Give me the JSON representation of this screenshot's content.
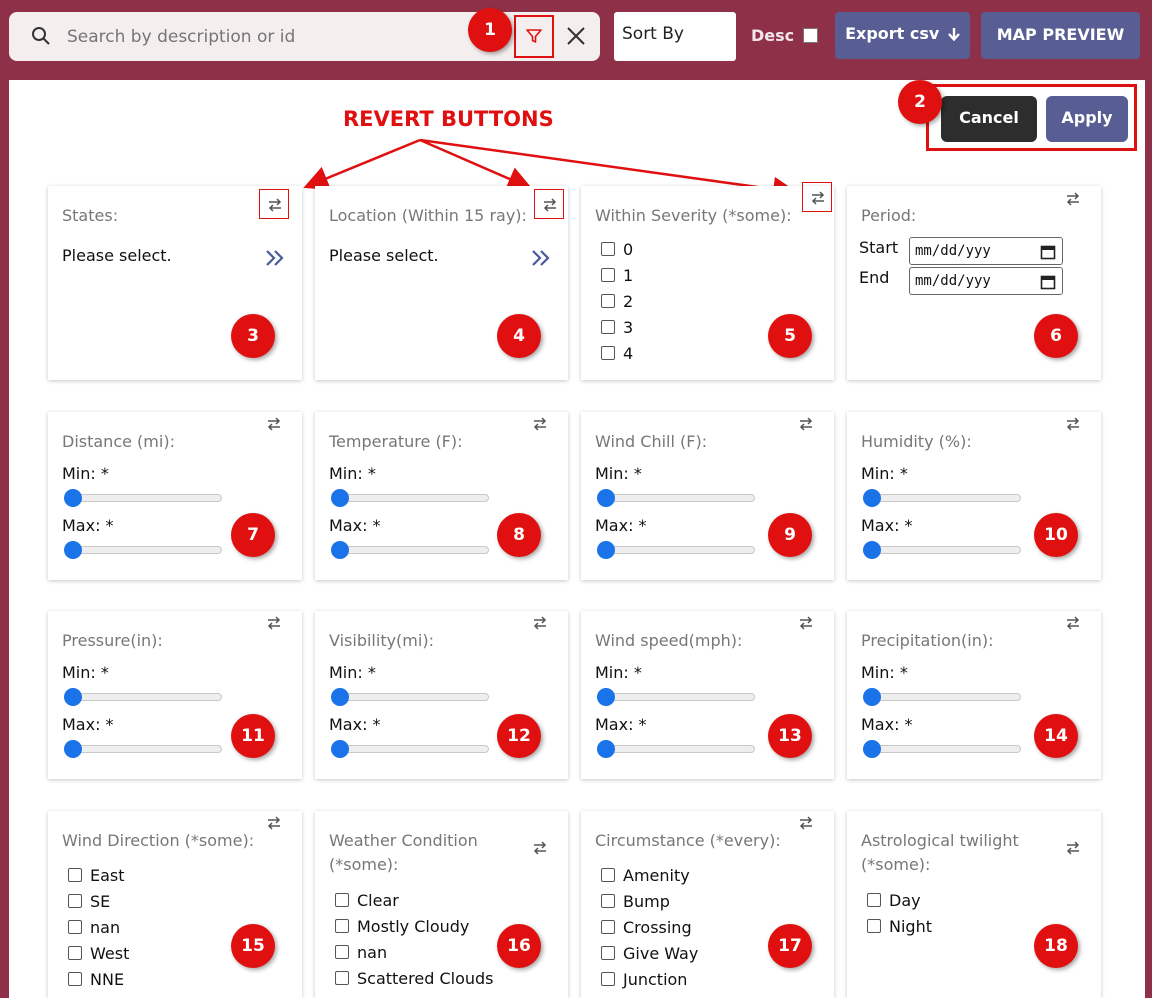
{
  "search": {
    "placeholder": "Search by description or id"
  },
  "toolbar": {
    "sort_by": "Sort By",
    "desc_label": "Desc",
    "export_label": "Export csv",
    "map_preview_label": "MAP PREVIEW",
    "cancel_label": "Cancel",
    "apply_label": "Apply"
  },
  "annotation": {
    "revert_title": "REVERT BUTTONS",
    "accent_color": "#e01010"
  },
  "badges": [
    "1",
    "2",
    "3",
    "4",
    "5",
    "6",
    "7",
    "8",
    "9",
    "10",
    "11",
    "12",
    "13",
    "14",
    "15",
    "16",
    "17",
    "18"
  ],
  "filters": {
    "states": {
      "title": "States:",
      "value": "Please select."
    },
    "location": {
      "title": "Location (Within 15 ray):",
      "value": "Please select."
    },
    "severity": {
      "title": "Within Severity (*some):",
      "options": [
        "0",
        "1",
        "2",
        "3",
        "4"
      ]
    },
    "period": {
      "title": "Period:",
      "start_label": "Start",
      "end_label": "End",
      "date_placeholder": "mm/dd/yyy"
    },
    "min_label": "Min: *",
    "max_label": "Max: *",
    "distance": {
      "title": "Distance (mi):"
    },
    "temperature": {
      "title": "Temperature (F):"
    },
    "wind_chill": {
      "title": "Wind Chill (F):"
    },
    "humidity": {
      "title": "Humidity (%):"
    },
    "pressure": {
      "title": "Pressure(in):"
    },
    "visibility": {
      "title": "Visibility(mi):"
    },
    "wind_speed": {
      "title": "Wind speed(mph):"
    },
    "precipitation": {
      "title": "Precipitation(in):"
    },
    "wind_direction": {
      "title": "Wind Direction (*some):",
      "options": [
        "East",
        "SE",
        "nan",
        "West",
        "NNE"
      ]
    },
    "weather_condition": {
      "title_line1": "Weather Condition",
      "title_line2": "(*some):",
      "options": [
        "Clear",
        "Mostly Cloudy",
        "nan",
        "Scattered Clouds"
      ]
    },
    "circumstance": {
      "title": "Circumstance (*every):",
      "options": [
        "Amenity",
        "Bump",
        "Crossing",
        "Give Way",
        "Junction"
      ]
    },
    "twilight": {
      "title_line1": "Astrological twilight",
      "title_line2": "(*some):",
      "options": [
        "Day",
        "Night"
      ]
    }
  },
  "colors": {
    "header_bg": "#8e3148",
    "button_bg": "#585e93",
    "slider_knob": "#1a73e8"
  }
}
